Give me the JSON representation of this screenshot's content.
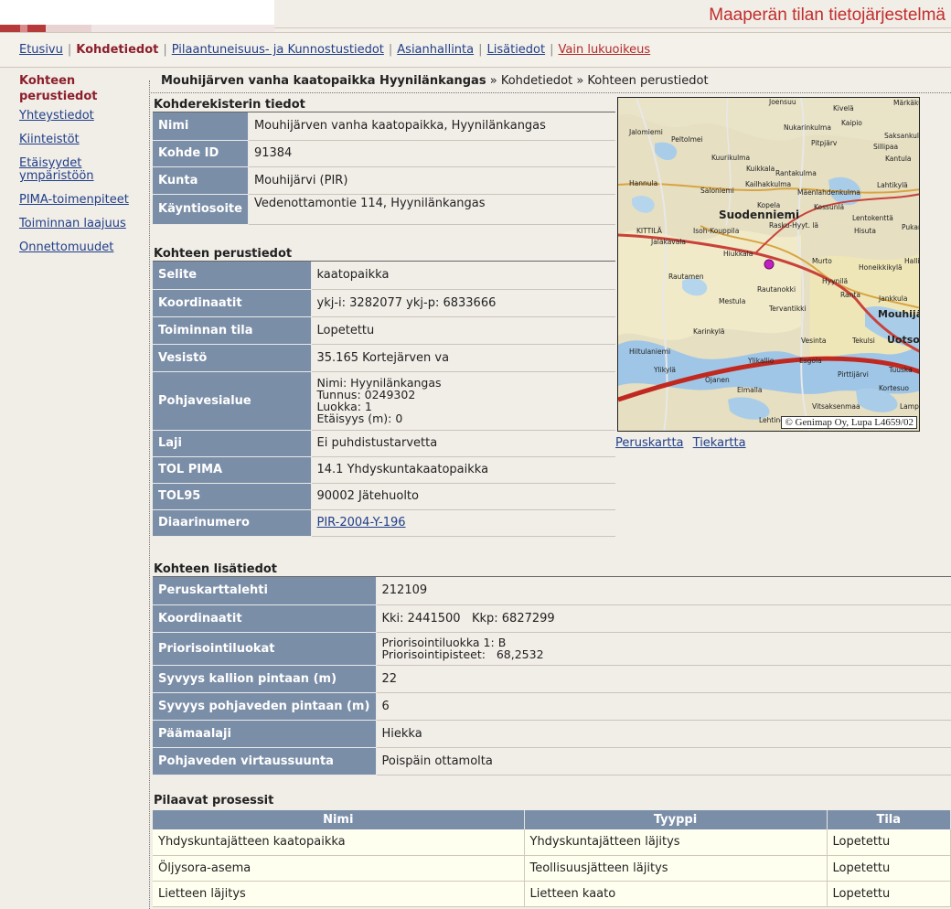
{
  "header": {
    "title": "Maaperän tilan tietojärjestelmä"
  },
  "nav": {
    "items": [
      {
        "label": "Etusivu"
      },
      {
        "label": "Kohdetiedot"
      },
      {
        "label": "Pilaantuneisuus- ja Kunnostustiedot"
      },
      {
        "label": "Asianhallinta"
      },
      {
        "label": "Lisätiedot"
      },
      {
        "label": "Vain lukuoikeus"
      }
    ],
    "separator": "|"
  },
  "sidebar": {
    "current": "Kohteen perustiedot",
    "links": [
      "Yhteystiedot",
      "Kiinteistöt",
      "Etäisyydet ympäristöön",
      "PIMA-toimenpiteet",
      "Toiminnan laajuus",
      "Onnettomuudet"
    ]
  },
  "breadcrumb": {
    "site": "Mouhijärven vanha kaatopaikka Hyynilänkangas",
    "sep": "»",
    "level1": "Kohdetiedot",
    "level2": "Kohteen perustiedot"
  },
  "register": {
    "title": "Kohderekisterin tiedot",
    "rows": [
      {
        "label": "Nimi",
        "value": "Mouhijärven vanha kaatopaikka, Hyynilänkangas"
      },
      {
        "label": "Kohde ID",
        "value": "91384"
      },
      {
        "label": "Kunta",
        "value": "Mouhijärvi (PIR)"
      },
      {
        "label": "Käyntiosoite",
        "value": "Vedenottamontie 114, Hyynilänkangas"
      }
    ]
  },
  "basic": {
    "title": "Kohteen perustiedot",
    "rows": [
      {
        "label": "Selite",
        "value": "kaatopaikka"
      },
      {
        "label": "Koordinaatit",
        "value": "ykj-i: 3282077 ykj-p: 6833666"
      },
      {
        "label": "Toiminnan tila",
        "value": "Lopetettu"
      },
      {
        "label": "Vesistö",
        "value": "35.165 Kortejärven va"
      },
      {
        "label": "Pohjavesialue",
        "lines": [
          "Nimi: Hyynilänkangas",
          "Tunnus: 0249302",
          "Luokka: 1",
          "Etäisyys (m): 0"
        ]
      },
      {
        "label": "Laji",
        "value": "Ei puhdistustarvetta"
      },
      {
        "label": "TOL PIMA",
        "value": "14.1 Yhdyskuntakaatopaikka"
      },
      {
        "label": "TOL95",
        "value": "90002 Jätehuolto"
      },
      {
        "label": "Diaarinumero",
        "value": "PIR-2004-Y-196"
      }
    ]
  },
  "map": {
    "credit": "© Genimap Oy, Lupa L4659/02",
    "links": [
      "Peruskartta",
      "Tiekartta"
    ],
    "places": [
      "Joensuu",
      "Kivelä",
      "Kaipio",
      "Märkäkulma",
      "Jalomiemi",
      "Nukarinkulma",
      "Saksankulm",
      "Peltolmei",
      "Pitpjärv",
      "Sillipaa",
      "Kantula",
      "Kuurikulma",
      "Kuikkala",
      "Hannula",
      "Rantakulma",
      "Kailhakkulma",
      "Lahtikylä",
      "Suodenniemi",
      "Kopela",
      "Kossunlä",
      "Lentokenttä",
      "Pukara",
      "KITTILÄ",
      "Isoh-Kouppila",
      "Rasku-Hyyt. lä",
      "Hisuta",
      "Jalakavala",
      "Hiukkala",
      "Murto",
      "Honeikkikylä",
      "Rautamen",
      "Hyynilä",
      "Rautanokki",
      "Mouhijä",
      "Mestula",
      "Tervantikki",
      "Karinkylä",
      "Hiltulaniemi",
      "Uotsola",
      "Vesinta",
      "Ylikallio",
      "Tekulsi",
      "Esgola",
      "Pirttijärvi",
      "Kortesuo",
      "Lampo",
      "Ojanen",
      "Tuuska",
      "Ylikylä",
      "Elmalla",
      "Vitsaksenmaa",
      "Mäenlahdenkulma",
      "Saloniemi",
      "Halli",
      "Jankkula",
      "Ranta",
      "Lehtinen"
    ]
  },
  "additional": {
    "title": "Kohteen lisätiedot",
    "rows": [
      {
        "label": "Peruskarttalehti",
        "value": "212109"
      },
      {
        "label": "Koordinaatit",
        "value": "Kki: 2441500   Kkp: 6827299"
      },
      {
        "label": "Priorisointiluokat",
        "lines": [
          "Priorisointiluokka 1: B",
          "Priorisointipisteet:   68,2532"
        ]
      },
      {
        "label": "Syvyys kallion pintaan (m)",
        "value": "22"
      },
      {
        "label": "Syvyys pohjaveden pintaan (m)",
        "value": "6"
      },
      {
        "label": "Päämaalaji",
        "value": "Hiekka"
      },
      {
        "label": "Pohjaveden virtaussuunta",
        "value": "Poispäin ottamolta"
      }
    ]
  },
  "processes": {
    "title": "Pilaavat prosessit",
    "headers": [
      "Nimi",
      "Tyyppi",
      "Tila"
    ],
    "rows": [
      [
        "Yhdyskuntajätteen kaatopaikka",
        "Yhdyskuntajätteen läjitys",
        "Lopetettu"
      ],
      [
        "Öljysora-asema",
        "Teollisuusjätteen läjitys",
        "Lopetettu"
      ],
      [
        "Lietteen läjitys",
        "Lietteen kaato",
        "Lopetettu"
      ]
    ]
  }
}
